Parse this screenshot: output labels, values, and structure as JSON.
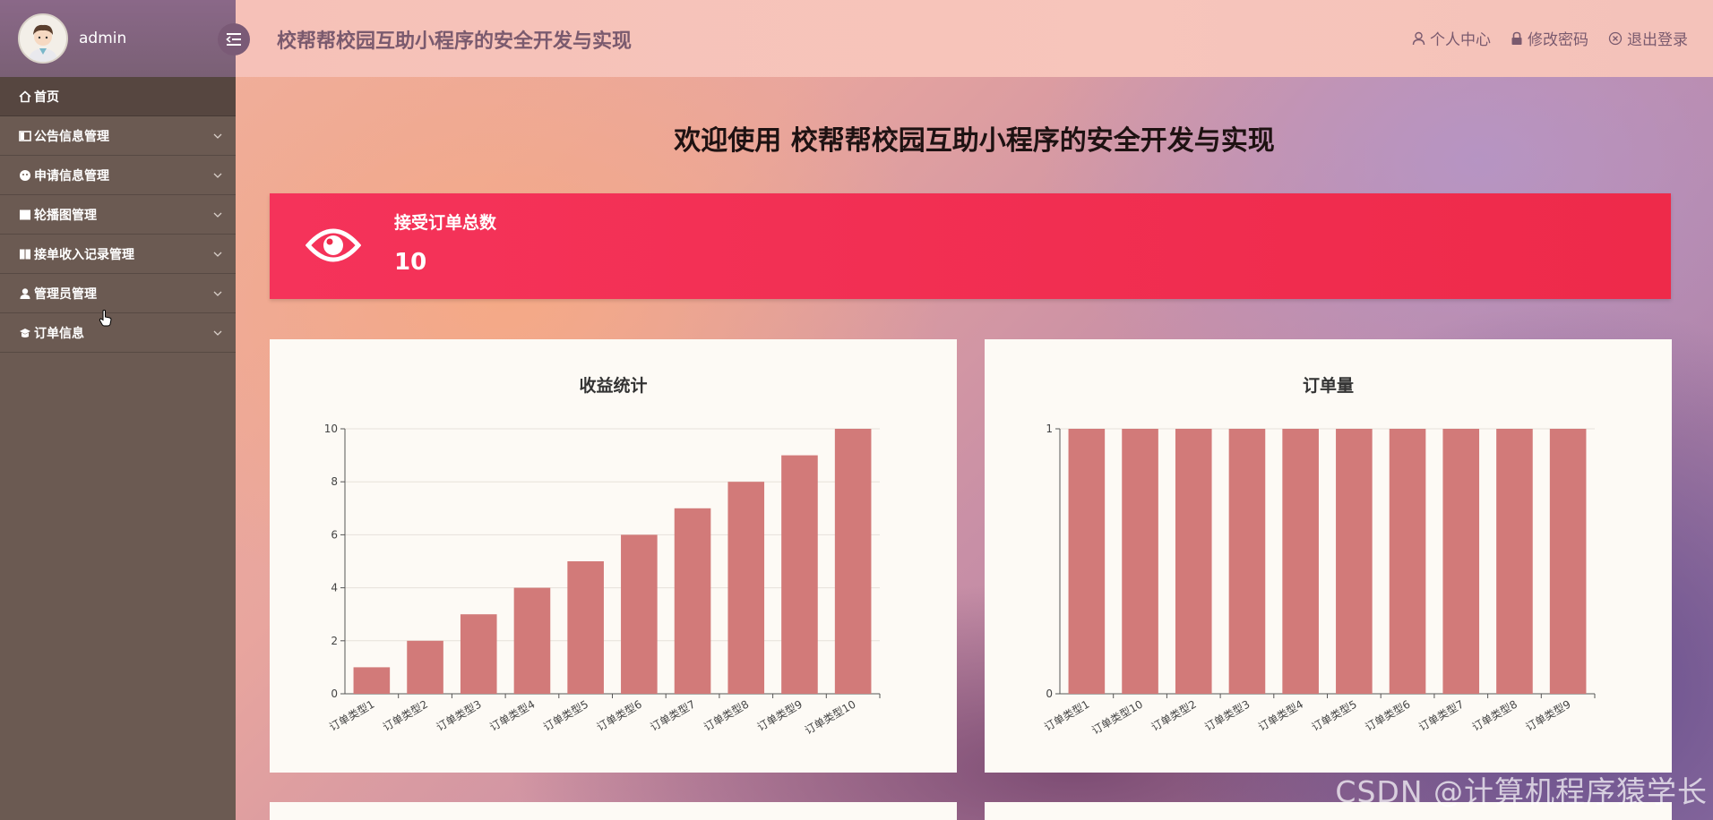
{
  "sidebar": {
    "username": "admin",
    "items": [
      {
        "label": "首页"
      },
      {
        "label": "公告信息管理"
      },
      {
        "label": "申请信息管理"
      },
      {
        "label": "轮播图管理"
      },
      {
        "label": "接单收入记录管理"
      },
      {
        "label": "管理员管理"
      },
      {
        "label": "订单信息"
      }
    ]
  },
  "header": {
    "title": "校帮帮校园互助小程序的安全开发与实现",
    "links": {
      "profile": "个人中心",
      "password": "修改密码",
      "logout": "退出登录"
    }
  },
  "main": {
    "welcome": "欢迎使用 校帮帮校园互助小程序的安全开发与实现",
    "stat": {
      "label": "接受订单总数",
      "value": "10"
    }
  },
  "colors": {
    "sidebar": "#6b5a52",
    "stat_card": "#f2304f",
    "bar": "#d27a79"
  },
  "watermark": "CSDN @计算机程序猿学长",
  "chart_data": [
    {
      "type": "bar",
      "title": "收益统计",
      "categories": [
        "订单类型1",
        "订单类型2",
        "订单类型3",
        "订单类型4",
        "订单类型5",
        "订单类型6",
        "订单类型7",
        "订单类型8",
        "订单类型9",
        "订单类型10"
      ],
      "values": [
        1,
        2,
        3,
        4,
        5,
        6,
        7,
        8,
        9,
        10
      ],
      "ylim": [
        0,
        10
      ],
      "yticks": [
        "0",
        "2",
        "4",
        "6",
        "8",
        "10"
      ],
      "grid": true
    },
    {
      "type": "bar",
      "title": "订单量",
      "categories": [
        "订单类型1",
        "订单类型10",
        "订单类型2",
        "订单类型3",
        "订单类型4",
        "订单类型5",
        "订单类型6",
        "订单类型7",
        "订单类型8",
        "订单类型9"
      ],
      "values": [
        1,
        1,
        1,
        1,
        1,
        1,
        1,
        1,
        1,
        1
      ],
      "ylim": [
        0,
        1
      ],
      "yticks": [
        "0",
        "1"
      ],
      "grid": true
    }
  ]
}
